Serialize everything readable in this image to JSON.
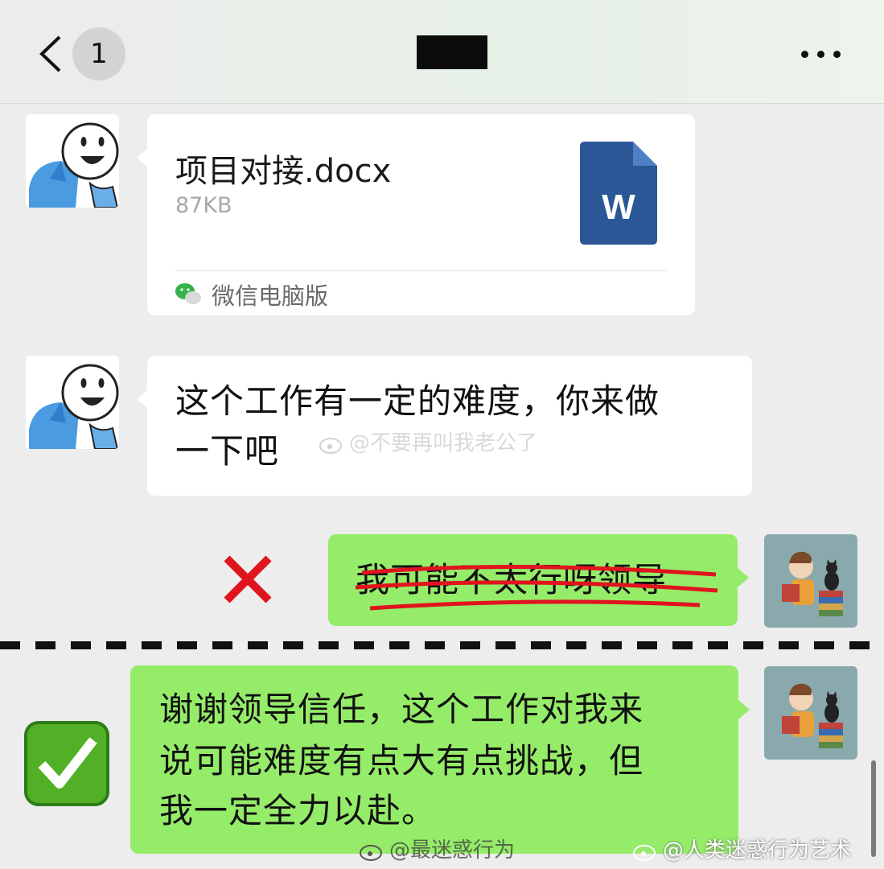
{
  "header": {
    "back_icon": "chevron-left-icon",
    "unread_count": "1",
    "more_icon": "more-horizontal-icon"
  },
  "messages": {
    "file": {
      "name": "项目对接.docx",
      "size": "87KB",
      "file_icon": "word-document-icon",
      "file_icon_letter": "W",
      "source_icon": "wechat-icon",
      "source": "微信电脑版"
    },
    "text1": {
      "line1": "这个工作有一定的难度，你来做",
      "line2": "一下吧"
    },
    "wrong_reply": {
      "mark_icon": "red-cross-icon",
      "text": "我可能不太行呀领导"
    },
    "right_reply": {
      "mark_icon": "green-check-icon",
      "line1": "谢谢领导信任，这个工作对我来",
      "line2": "说可能难度有点大有点挑战，但",
      "line3": "我一定全力以赴。"
    }
  },
  "watermarks": {
    "center": "@不要再叫我老公了",
    "bottom_left": "@最迷惑行为",
    "bottom_right": "@人类迷惑行为艺术"
  },
  "colors": {
    "green_bubble": "#95ec69",
    "white_bubble": "#ffffff",
    "word_blue": "#2b5797",
    "cross_red": "#e0141e",
    "check_green": "#52b026"
  }
}
